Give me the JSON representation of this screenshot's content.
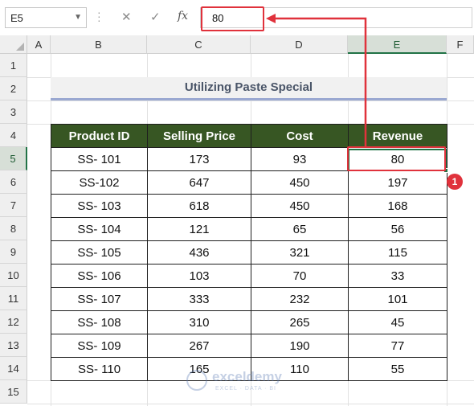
{
  "formula_bar": {
    "name_box": "E5",
    "cancel_glyph": "✕",
    "enter_glyph": "✓",
    "fx_label": "fx",
    "formula_value": "80"
  },
  "columns": [
    "A",
    "B",
    "C",
    "D",
    "E",
    "F"
  ],
  "rows": [
    "1",
    "2",
    "3",
    "4",
    "5",
    "6",
    "7",
    "8",
    "9",
    "10",
    "11",
    "12",
    "13",
    "14",
    "15"
  ],
  "active_cell": {
    "column": "E",
    "row": "5"
  },
  "sheet": {
    "title": "Utilizing Paste Special",
    "table": {
      "headers": [
        "Product ID",
        "Selling Price",
        "Cost",
        "Revenue"
      ],
      "rows": [
        [
          "SS- 101",
          "173",
          "93",
          "80"
        ],
        [
          "SS-102",
          "647",
          "450",
          "197"
        ],
        [
          "SS- 103",
          "618",
          "450",
          "168"
        ],
        [
          "SS- 104",
          "121",
          "65",
          "56"
        ],
        [
          "SS- 105",
          "436",
          "321",
          "115"
        ],
        [
          "SS- 106",
          "103",
          "70",
          "33"
        ],
        [
          "SS- 107",
          "333",
          "232",
          "101"
        ],
        [
          "SS- 108",
          "310",
          "265",
          "45"
        ],
        [
          "SS- 109",
          "267",
          "190",
          "77"
        ],
        [
          "SS- 110",
          "165",
          "110",
          "55"
        ]
      ]
    }
  },
  "annotation": {
    "badge": "1",
    "color": "#e0323c"
  },
  "watermark": {
    "brand": "exceldemy",
    "tagline": "EXCEL · DATA · BI"
  },
  "colors": {
    "header_fill": "#375623",
    "selection": "#217346",
    "title_underline": "#9aa8d1"
  }
}
